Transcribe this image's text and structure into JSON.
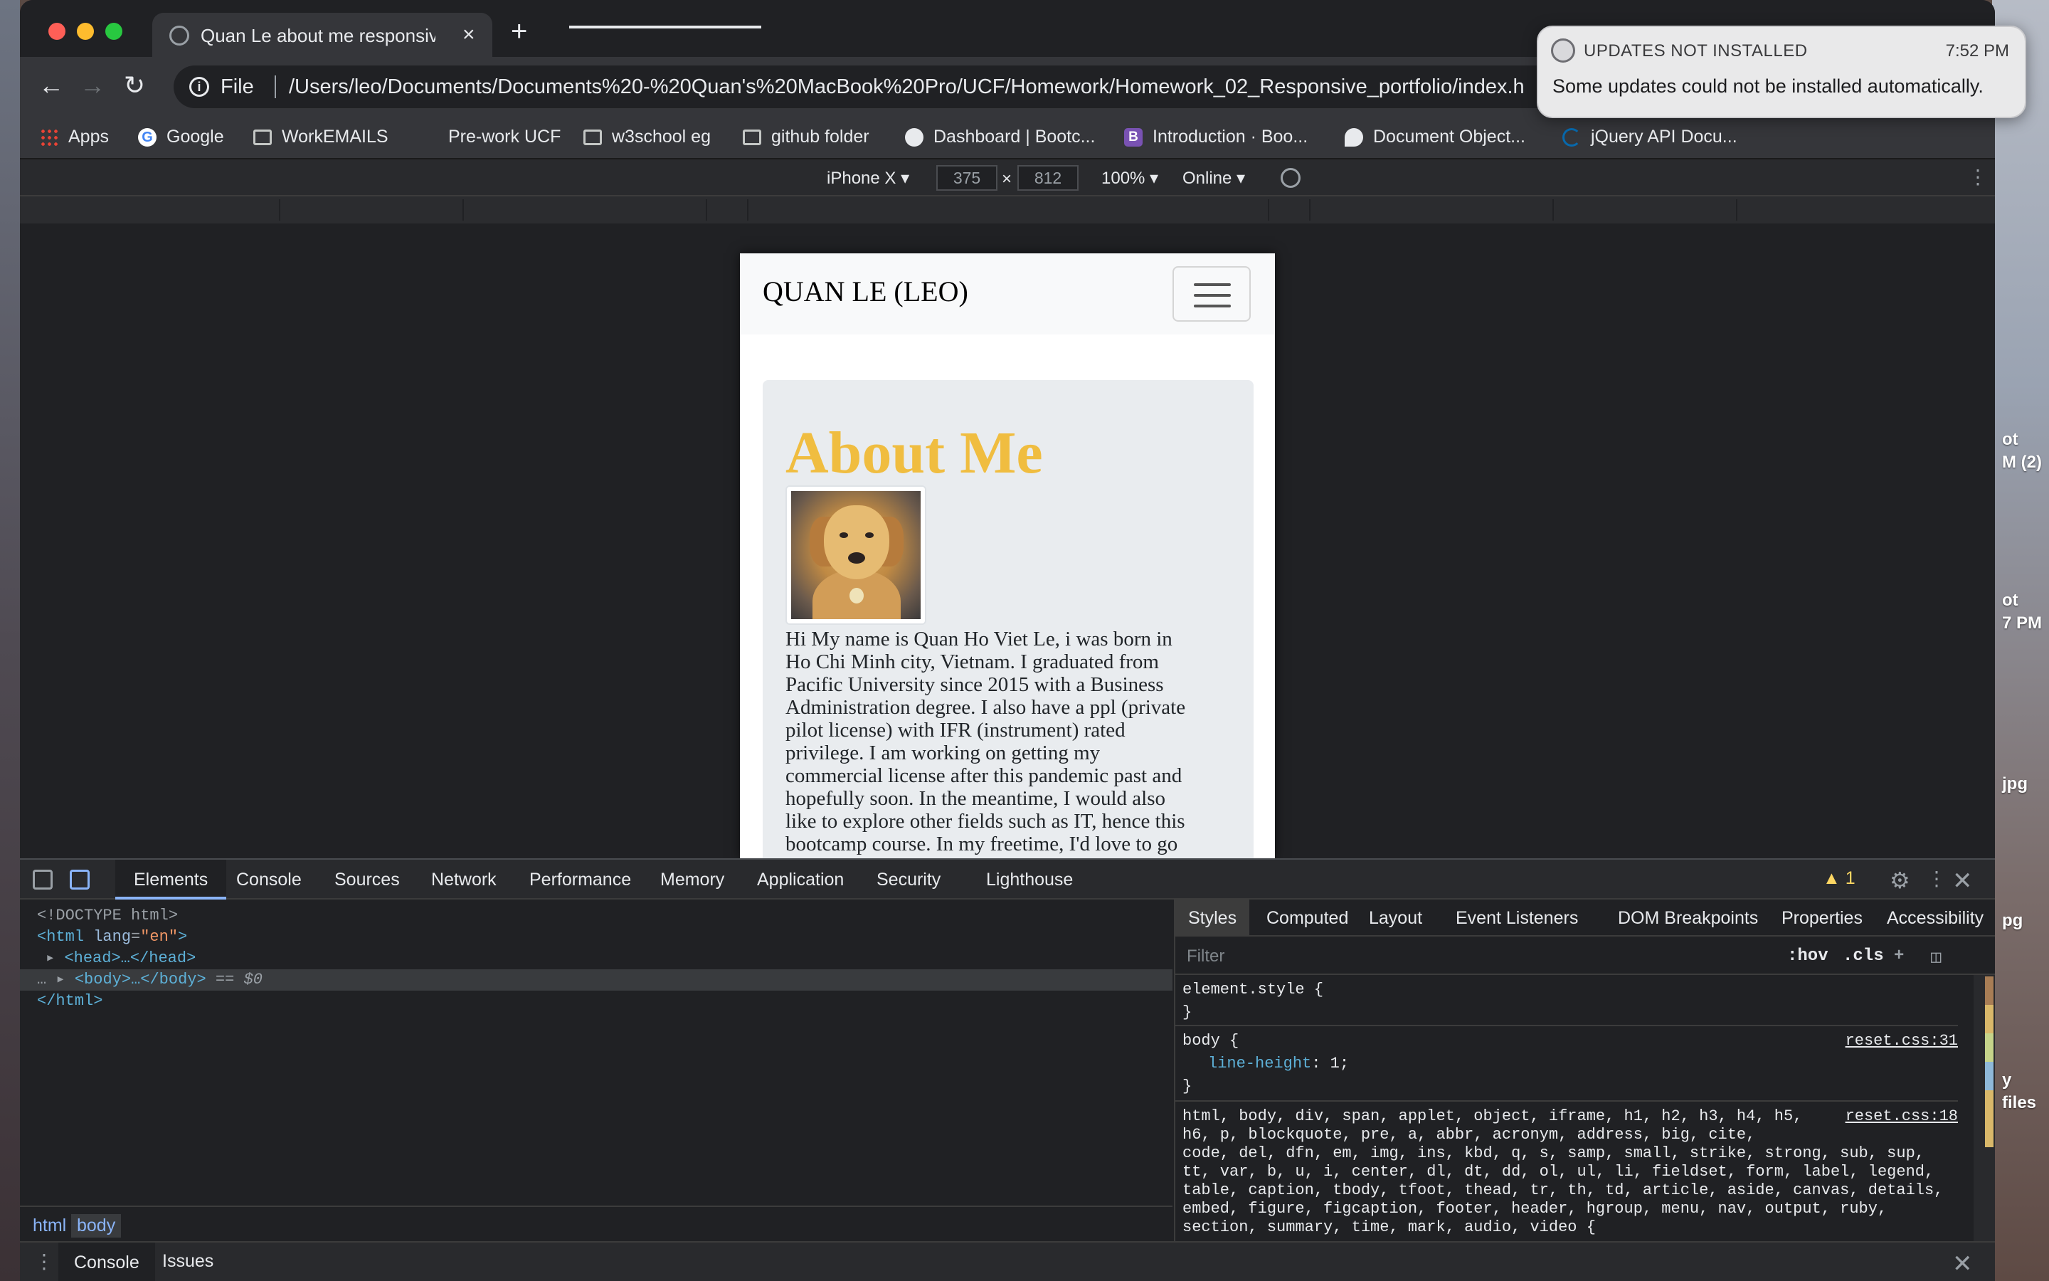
{
  "desktop": {
    "labels": [
      "ot",
      "M (2)",
      "ot",
      "7 PM",
      "jpg",
      "pg",
      "y",
      "files"
    ]
  },
  "browser": {
    "tab_title": "Quan Le about me responsive p",
    "tab_close": "×",
    "new_tab": "+",
    "omnibox": {
      "scheme": "File",
      "url": "/Users/leo/Documents/Documents%20-%20Quan's%20MacBook%20Pro/UCF/Homework/Homework_02_Responsive_portfolio/index.h"
    },
    "bookmarks": [
      {
        "label": "Apps",
        "icon": "apps-grid-icon"
      },
      {
        "label": "Google",
        "icon": "google-icon"
      },
      {
        "label": "WorkEMAILS",
        "icon": "folder-icon"
      },
      {
        "label": "Pre-work UCF",
        "icon": "none"
      },
      {
        "label": "w3school eg",
        "icon": "folder-icon"
      },
      {
        "label": "github folder",
        "icon": "folder-icon"
      },
      {
        "label": "Dashboard | Bootc...",
        "icon": "globe-icon"
      },
      {
        "label": "Introduction · Boo...",
        "icon": "bootstrap-icon"
      },
      {
        "label": "Document Object...",
        "icon": "dom-icon"
      },
      {
        "label": "jQuery API Docu...",
        "icon": "jquery-icon"
      }
    ]
  },
  "device_toolbar": {
    "device": "iPhone X ▾",
    "width": "375",
    "times": "×",
    "height": "812",
    "zoom": "100% ▾",
    "network": "Online ▾"
  },
  "site": {
    "brand": "QUAN LE (LEO)",
    "heading": "About Me",
    "bio_lines": [
      "Hi My name is Quan Ho Viet Le, i was born in",
      "Ho Chi Minh city, Vietnam. I graduated from",
      "Pacific University since 2015 with a Business",
      "Administration degree. I also have a ppl (private",
      "pilot license) with IFR (instrument) rated",
      "privilege. I am working on getting my",
      "commercial license after this pandemic past and",
      "hopefully soon. In the meantime, I would also",
      "like to explore other fields such as IT, hence this",
      "bootcamp course. In my freetime, I'd love to go"
    ],
    "colors": {
      "heading": "#f0bd40",
      "jumbotron": "#e9ecef",
      "navbar": "#f8f9fa"
    }
  },
  "notification": {
    "title": "UPDATES NOT INSTALLED",
    "time": "7:52 PM",
    "body": "Some updates could not be installed automatically."
  },
  "devtools": {
    "tabs": [
      "Elements",
      "Console",
      "Sources",
      "Network",
      "Performance",
      "Memory",
      "Application",
      "Security",
      "Lighthouse"
    ],
    "warning_count": "1",
    "dom": {
      "doctype": "<!DOCTYPE html>",
      "html_open_tag": "<html",
      "html_attr": "lang",
      "html_attr_val": "\"en\"",
      "head": "<head>…</head>",
      "body": "<body>…</body>",
      "body_suffix": "== $0",
      "html_close": "</html>"
    },
    "styles_tabs": [
      "Styles",
      "Computed",
      "Layout",
      "Event Listeners",
      "DOM Breakpoints",
      "Properties",
      "Accessibility"
    ],
    "filter_placeholder": "Filter",
    "hov": ":hov",
    "cls": ".cls",
    "rules": {
      "element_style_open": "element.style {",
      "close": "}",
      "body_selector": "body {",
      "body_prop": "line-height",
      "body_val": "1;",
      "body_src": "reset.css:31",
      "reset_src": "reset.css:18",
      "reset_lines": [
        "html, body, div, span, applet, object, iframe, h1, h2, h3, h4, h5,",
        "h6, p, blockquote, pre, a, abbr, acronym, address, big, cite,",
        "code, del, dfn, em, img, ins, kbd, q, s, samp, small, strike, strong, sub, sup,",
        "tt, var, b, u, i, center, dl, dt, dd, ol, ul, li, fieldset, form, label, legend,",
        "table, caption, tbody, tfoot, thead, tr, th, td, article, aside, canvas, details,",
        "embed, figure, figcaption, footer, header, hgroup, menu, nav, output, ruby,",
        "section, summary, time, mark, audio, video {"
      ]
    },
    "breadcrumbs": [
      "html",
      "body"
    ],
    "drawer_tabs": [
      "Console",
      "Issues"
    ]
  }
}
